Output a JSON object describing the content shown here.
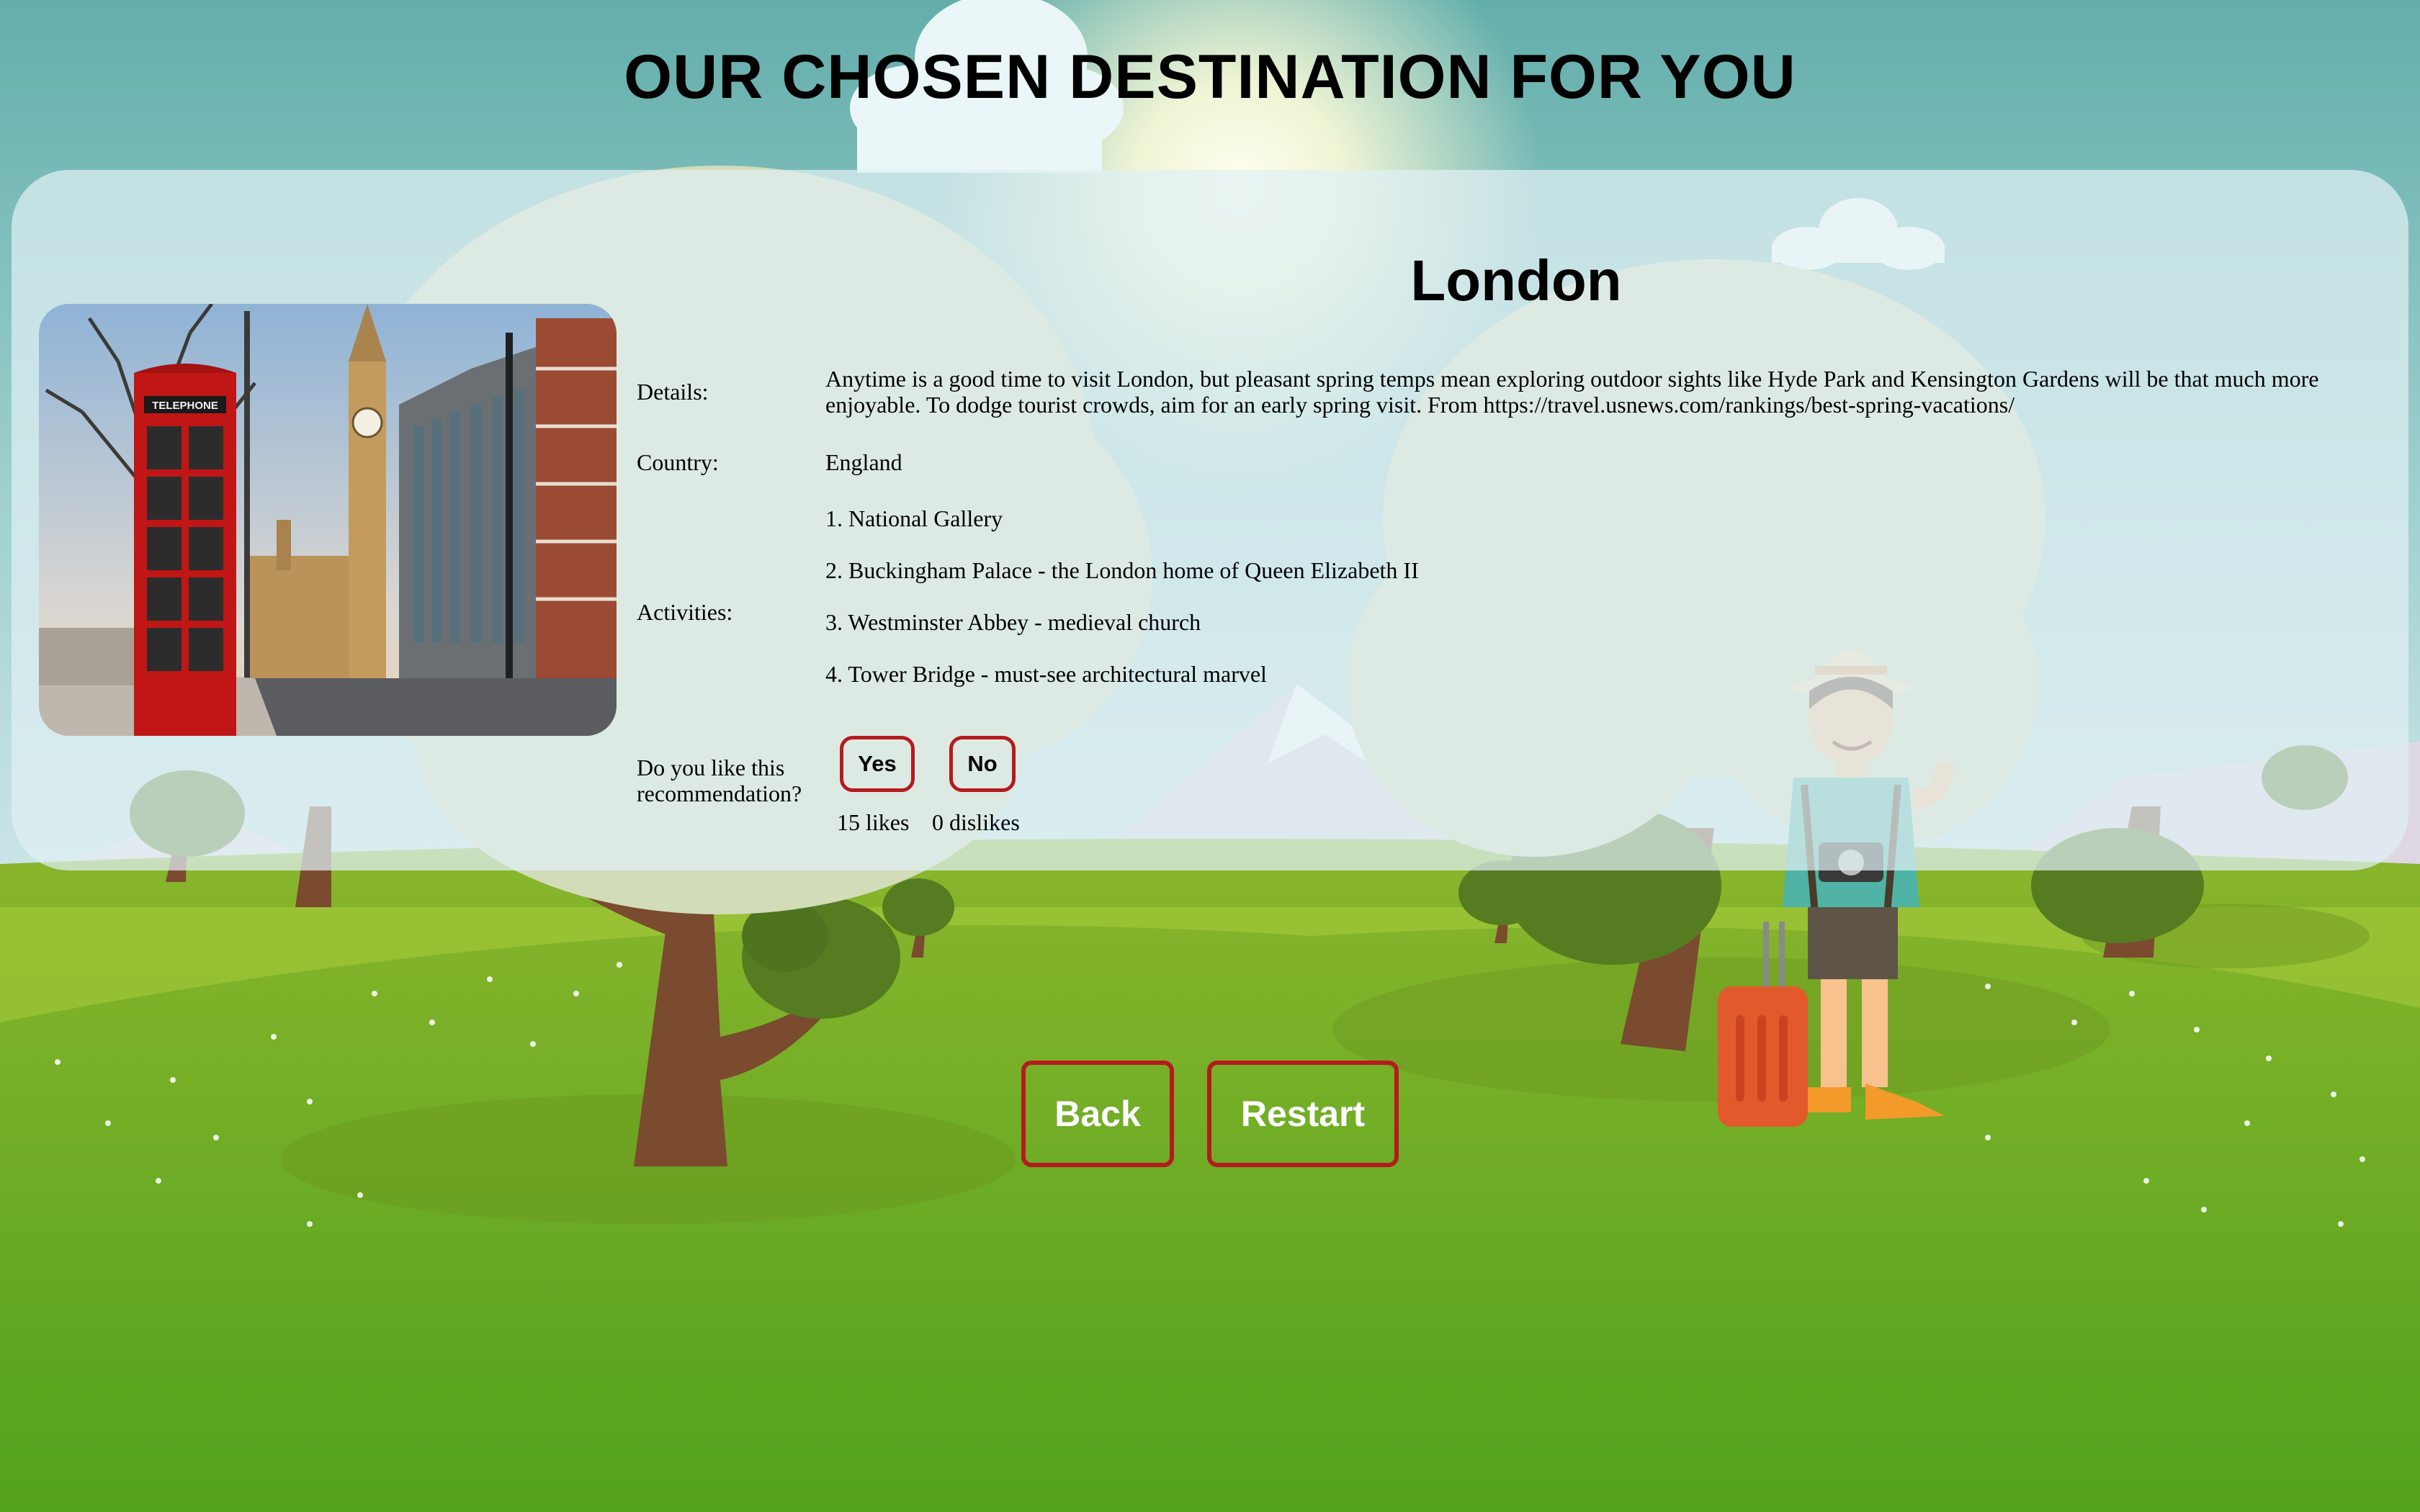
{
  "page": {
    "title": "OUR CHOSEN DESTINATION FOR YOU"
  },
  "destination": {
    "name": "London",
    "details_label": "Details:",
    "details": "Anytime is a good time to visit London, but pleasant spring temps mean exploring outdoor sights like Hyde Park and Kensington Gardens will be that much more enjoyable. To dodge tourist crowds, aim for an early spring visit. From https://travel.usnews.com/rankings/best-spring-vacations/",
    "country_label": "Country:",
    "country": "England",
    "activities_label": "Activities:",
    "activities": [
      "1. National Gallery",
      "2. Buckingham Palace - the London home of Queen Elizabeth II",
      "3. Westminster Abbey - medieval church",
      "4. Tower Bridge - must-see architectural marvel"
    ],
    "photo_sign_text": "TELEPHONE"
  },
  "feedback": {
    "question": "Do you like this recommendation?",
    "yes_label": "Yes",
    "no_label": "No",
    "likes": "15 likes",
    "dislikes": "0 dislikes"
  },
  "nav": {
    "back_label": "Back",
    "restart_label": "Restart"
  },
  "colors": {
    "sky": "#68b1ae",
    "grass": "#5aa51f",
    "button_border": "#b51a1f",
    "card": "#e1f0f4"
  }
}
